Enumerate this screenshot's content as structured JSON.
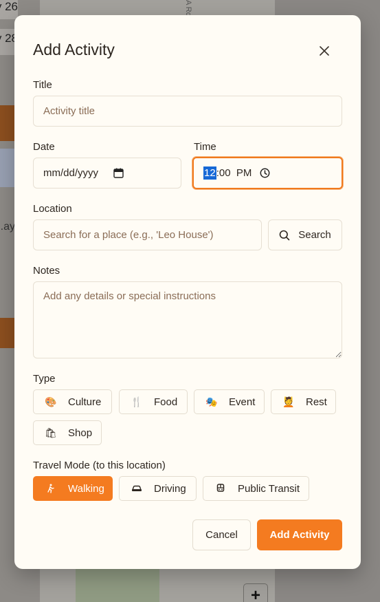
{
  "background": {
    "date_1": "y 26",
    "date_2": "y 28",
    "text_fragment": "ay.",
    "map_road_label": "A Rd",
    "zoom_in_label": "+"
  },
  "modal": {
    "title": "Add Activity",
    "close_icon": "close-icon"
  },
  "form": {
    "title_label": "Title",
    "title_placeholder": "Activity title",
    "date_label": "Date",
    "date_placeholder": "mm/dd/yyyy",
    "time_label": "Time",
    "time_hour": "12",
    "time_rest": ":00  PM",
    "location_label": "Location",
    "location_placeholder": "Search for a place (e.g., 'Leo House')",
    "search_button": "Search",
    "notes_label": "Notes",
    "notes_placeholder": "Add any details or special instructions",
    "type_label": "Type",
    "types": [
      {
        "label": "Culture",
        "icon": "🎨"
      },
      {
        "label": "Food",
        "icon": "🍴"
      },
      {
        "label": "Event",
        "icon": "🎭"
      },
      {
        "label": "Rest",
        "icon": "💆"
      },
      {
        "label": "Shop",
        "icon": "🛍"
      }
    ],
    "travel_mode_label": "Travel Mode (to this location)",
    "travel_modes": [
      {
        "label": "Walking",
        "icon": "walking-icon",
        "selected": true
      },
      {
        "label": "Driving",
        "icon": "car-icon",
        "selected": false
      },
      {
        "label": "Public Transit",
        "icon": "transit-icon",
        "selected": false
      }
    ]
  },
  "footer": {
    "cancel_button": "Cancel",
    "submit_button": "Add Activity"
  },
  "colors": {
    "accent": "#f47b20",
    "modal_bg": "#fffcf5",
    "focus_ring": "#f07a1e"
  }
}
